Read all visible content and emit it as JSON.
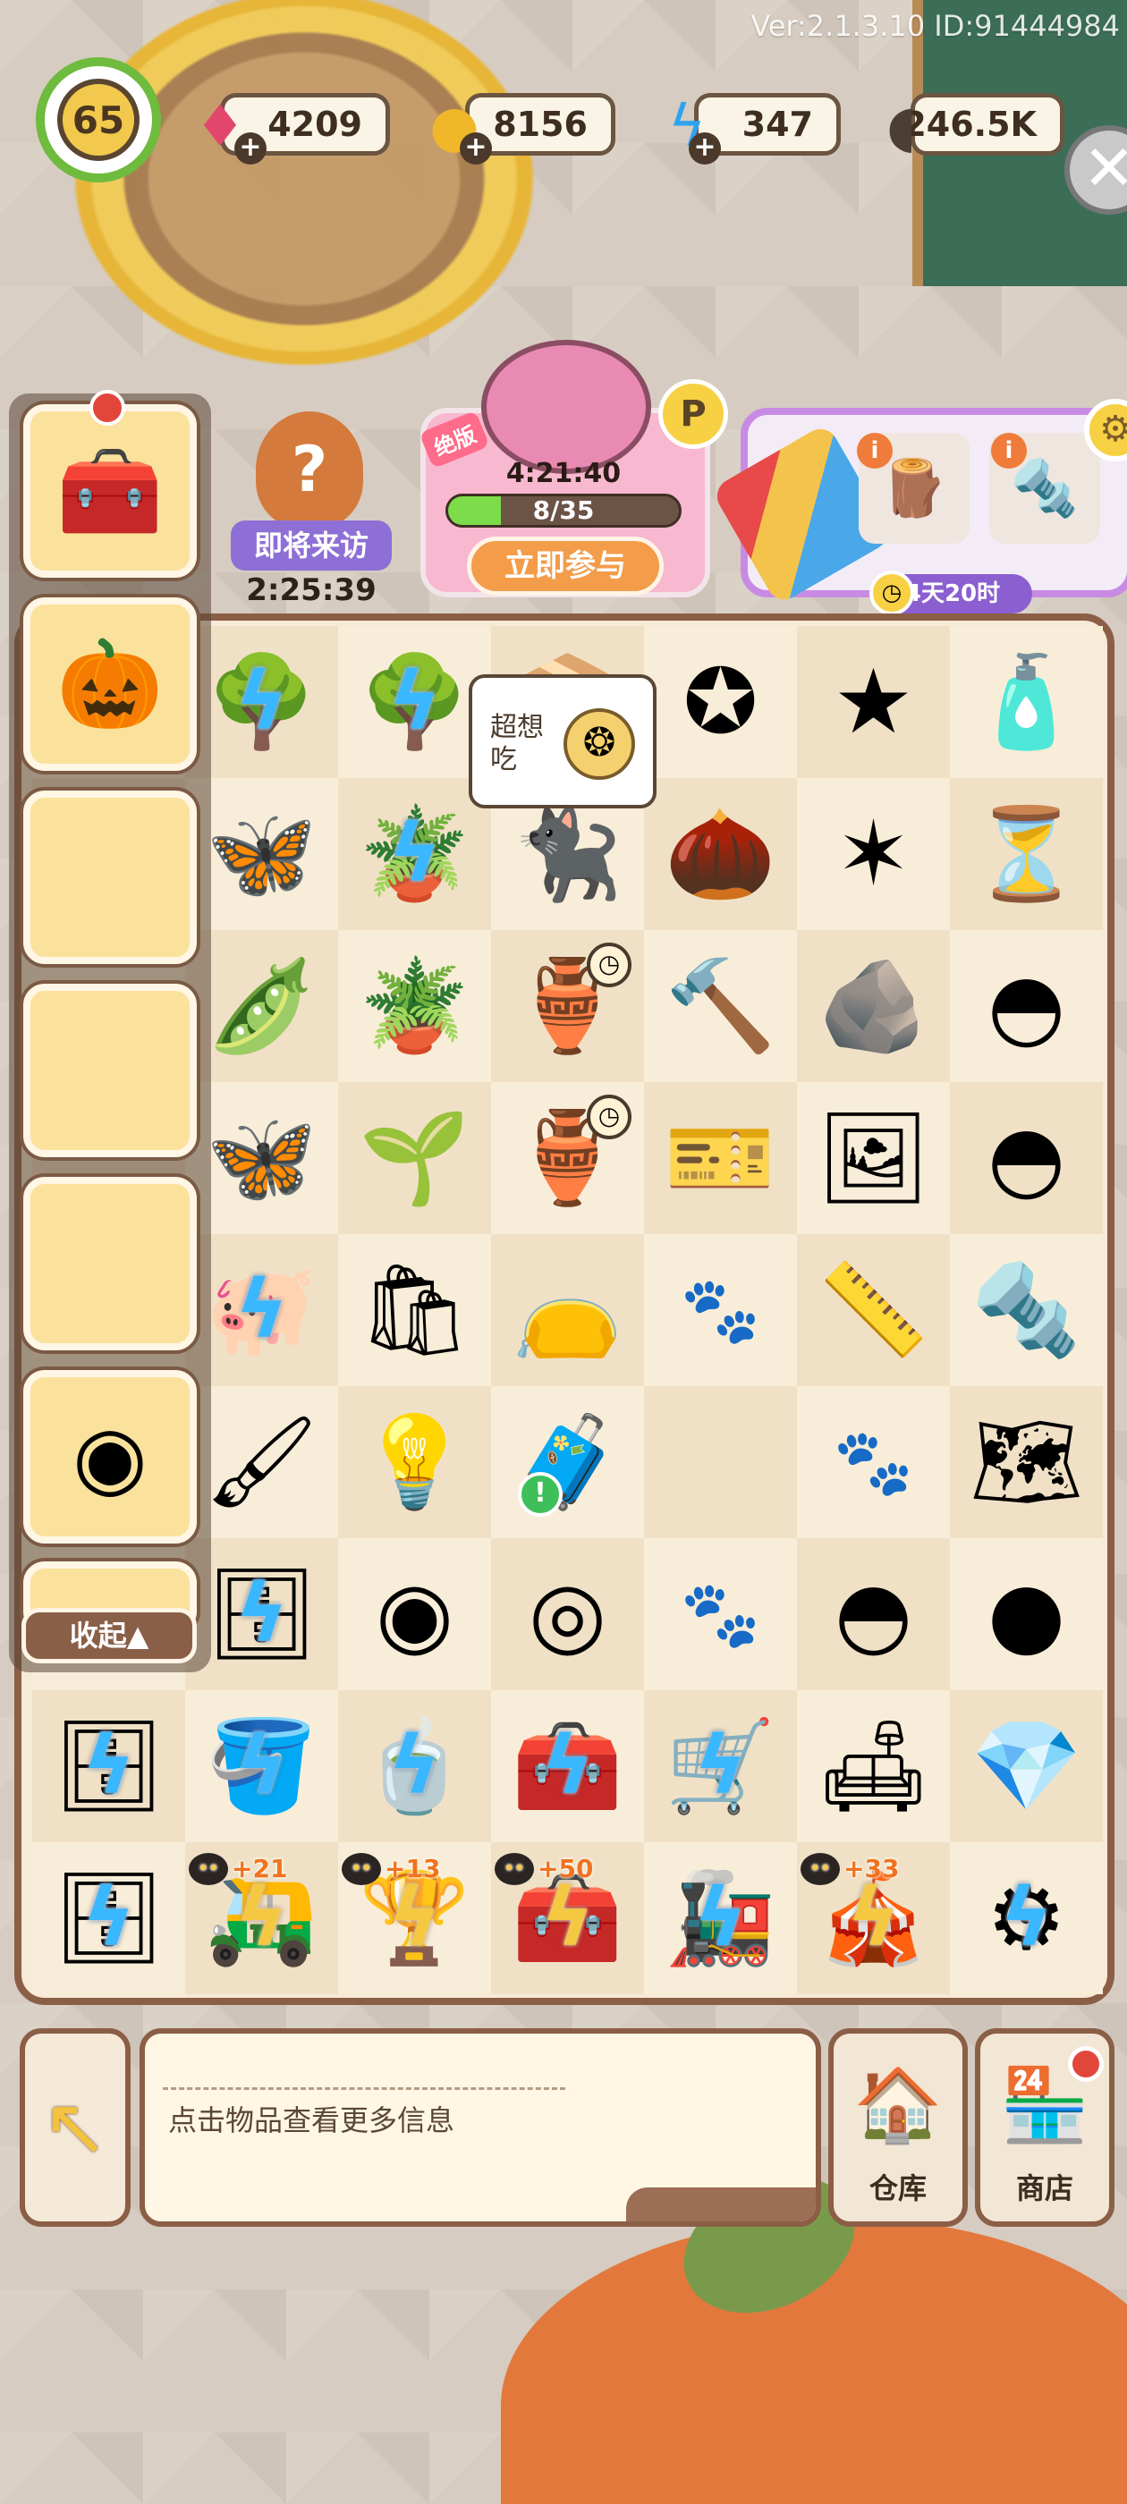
{
  "version": "Ver:2.1.3.10 ID:91444984",
  "player": {
    "level": "65"
  },
  "resources": {
    "gems": "4209",
    "coins": "8156",
    "energy": "347",
    "seeds": "246.5K"
  },
  "visitor": {
    "label": "即将来访",
    "countdown": "2:25:39",
    "icon": "question-mark"
  },
  "event": {
    "badge": "绝版",
    "timer": "4:21:40",
    "progress_text": "8/35",
    "progress": 0.23,
    "join_label": "立即参与"
  },
  "task": {
    "timer": "4天20时",
    "slot1_icon": "wood-logs",
    "slot2_icon": "screws"
  },
  "sidebar": {
    "slots": [
      "treasure-chest",
      "pumpkin-lock",
      "",
      "",
      "",
      "film-reel",
      "partial-item"
    ],
    "collapse_label": "收起▲"
  },
  "speech": {
    "text": "超想吃",
    "icon": "gold-gem-medal"
  },
  "board": {
    "rows": [
      [
        "",
        "tree-bolt",
        "tree-bolt",
        "crate",
        "blue-star-badge",
        "blue-stars",
        "spray-bottle"
      ],
      [
        "",
        "butterfly",
        "blue-flower-bolt",
        "black-cat",
        "acorns",
        "blue-stars-pair",
        "hourglass"
      ],
      [
        "",
        "green-beans",
        "blue-flower-pot",
        "flower-vase-cd",
        "hammer",
        "ore-rock",
        "sand-ball"
      ],
      [
        "",
        "moth",
        "sprout-pot",
        "blue-vase-cd",
        "tickets",
        "photo",
        "sand-balls-pair"
      ],
      [
        "",
        "piggy-bank-bolt",
        "seed-bags",
        "seed-bag",
        "paw",
        "tape-measure",
        "screws"
      ],
      [
        "",
        "paint-tubes",
        "lightbulb",
        "chest-alert",
        "",
        "paw",
        "map"
      ],
      [
        "",
        "drawer-bolt",
        "film-reel",
        "film-reel-small",
        "paw",
        "sand-balls-three",
        "sand-ball-large"
      ],
      [
        "shelf-bolt",
        "planter-bolt",
        "pot-bolt",
        "toolbox-bolt",
        "cart-bolt",
        "lamp",
        "pink-gem"
      ],
      [
        "cabinet-bolt",
        "wagon-gold",
        "vase-gold",
        "toolbox-gold",
        "train-bolt",
        "stand-gold",
        "machine-bolt"
      ]
    ],
    "tags": {
      "r8c1": "+21",
      "r8c2": "+13",
      "r8c3": "+50",
      "r8c5": "+33"
    }
  },
  "bottom": {
    "info_text": "点击物品查看更多信息",
    "warehouse_label": "仓库",
    "shop_label": "商店"
  },
  "colors": {
    "accent_green": "#6ebb3e",
    "board_border": "#8b5e46",
    "event_pink": "#f7b8d0",
    "task_purple": "#c88be3"
  }
}
